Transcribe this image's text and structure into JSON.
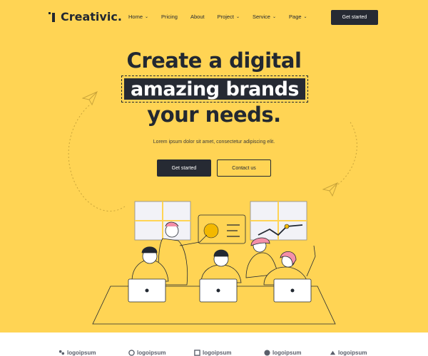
{
  "brand": {
    "name": "Creativic."
  },
  "nav": [
    {
      "label": "Home",
      "chev": "⌄"
    },
    {
      "label": "Pricing",
      "chev": ""
    },
    {
      "label": "About",
      "chev": ""
    },
    {
      "label": "Project",
      "chev": "⌄"
    },
    {
      "label": "Service",
      "chev": "⌄"
    },
    {
      "label": "Page",
      "chev": "⌄"
    }
  ],
  "header_cta": "Get started",
  "hero": {
    "line1": "Create a digital",
    "highlight": "amazing brands",
    "line3": "your needs.",
    "subtitle": "Lorem ipsum dolor sit amet, consectetur adipiscing elit.",
    "primary_btn": "Get started",
    "secondary_btn": "Contact us"
  },
  "clients": [
    "logoipsum",
    "logoipsum",
    "logoipsum",
    "logoipsum",
    "logoipsum"
  ],
  "colors": {
    "background": "#ffd454",
    "dark": "#262a33",
    "accent_pink": "#f48fa8",
    "white": "#ffffff"
  }
}
